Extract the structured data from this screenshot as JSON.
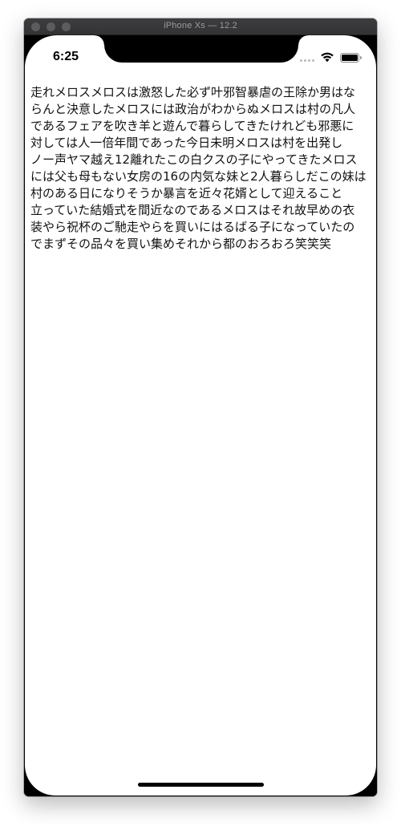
{
  "window": {
    "title": "iPhone Xs — 12.2"
  },
  "status_bar": {
    "time": "6:25",
    "icons": [
      "cellular-signal-icon",
      "wifi-icon",
      "battery-icon"
    ]
  },
  "content": {
    "lines": [
      "走れメロスメロスは激怒した必ず叶邪智暴虐の王除か男はな",
      "らんと決意したメロスには政治がわからぬメロスは村の凡人",
      "であるフェアを吹き羊と遊んで暮らしてきたけれども邪悪に",
      "対しては人一倍年間であった今日未明メロスは村を出発し",
      "ノー声ヤマ越え12離れたこの白クスの子にやってきたメロス",
      "には父も母もない女房の16の内気な妹と2人暮らしだこの妹は",
      "村のある日になりそうか暴言を近々花婿として迎えること",
      "立っていた結婚式を間近なのであるメロスはそれ故早めの衣",
      "装やら祝杯のご馳走やらを買いにはるばる子になっていたの",
      "でまずその品々を買い集めそれから都のおろおろ笑笑笑"
    ]
  },
  "colors": {
    "titlebar": "#363638",
    "device_frame": "#000000",
    "screen_background": "#ffffff",
    "text": "#111111"
  }
}
